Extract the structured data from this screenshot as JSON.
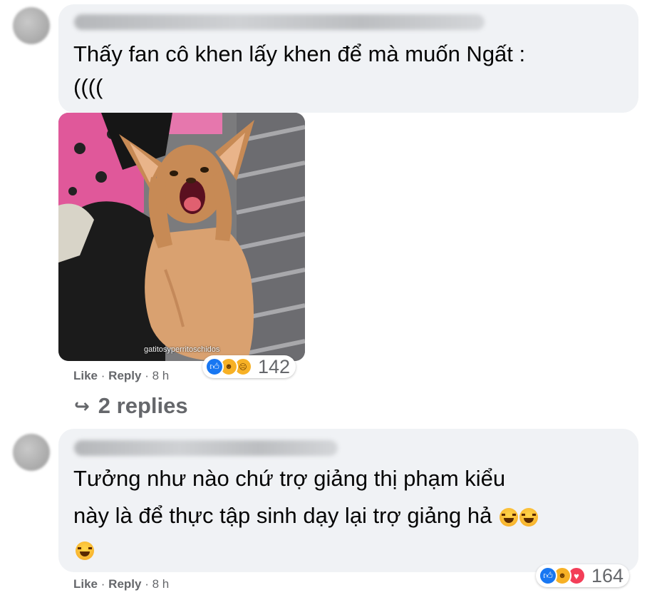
{
  "comments": [
    {
      "text_line1": "Thấy fan cô khen lấy khen để mà muốn Ngất :",
      "text_line2": "((((",
      "image_caption": "gatitosyperritoschidos",
      "actions": {
        "like": "Like",
        "separator": "·",
        "reply": "Reply",
        "time": "8 h"
      },
      "reactions": {
        "icons": [
          "like",
          "haha",
          "sad"
        ],
        "count": "142"
      },
      "replies_label": "2 replies",
      "replies_icon": "↪"
    },
    {
      "text_line1": "Tưởng như nào chứ trợ giảng thị phạm kiểu",
      "text_line2": "này là để thực tập sinh dạy lại trợ giảng hả",
      "actions": {
        "like": "Like",
        "separator": "·",
        "reply": "Reply",
        "time": "8 h"
      },
      "reactions": {
        "icons": [
          "like",
          "haha",
          "love"
        ],
        "count": "164"
      }
    }
  ],
  "colors": {
    "bubble": "#f0f2f5",
    "meta_text": "#65676b",
    "like_blue": "#1877f2",
    "love_red": "#f33e58",
    "haha_yellow": "#f7b125"
  }
}
